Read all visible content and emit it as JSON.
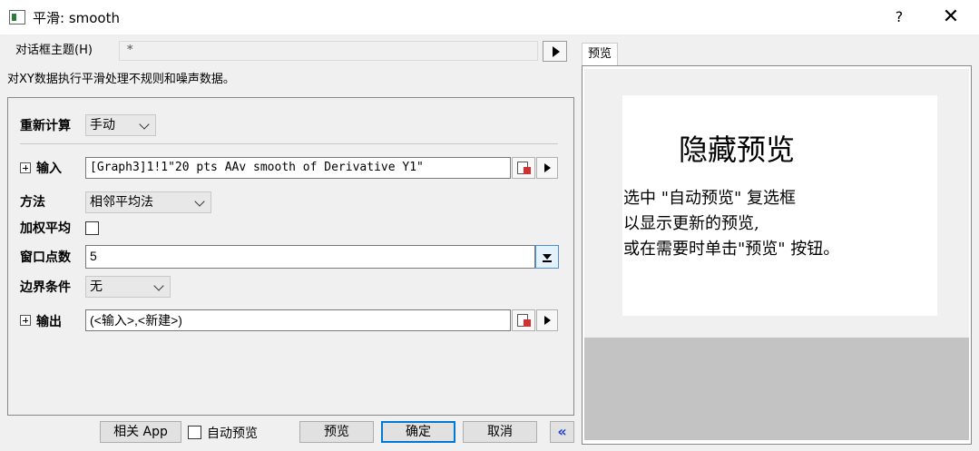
{
  "window": {
    "title": "平滑: smooth",
    "help_glyph": "?",
    "close_glyph": "✕"
  },
  "theme": {
    "label": "对话框主题(H)",
    "value": "*"
  },
  "description": "对XY数据执行平滑处理不规则和噪声数据。",
  "form": {
    "recalc": {
      "label": "重新计算",
      "value": "手动"
    },
    "input": {
      "label": "输入",
      "value": "[Graph3]1!1\"20 pts AAv smooth of Derivative Y1\""
    },
    "method": {
      "label": "方法",
      "value": "相邻平均法"
    },
    "weighted": {
      "label": "加权平均",
      "checked": false
    },
    "window_points": {
      "label": "窗口点数",
      "value": "5"
    },
    "boundary": {
      "label": "边界条件",
      "value": "无"
    },
    "output": {
      "label": "输出",
      "value": "(<输入>,<新建>)"
    }
  },
  "buttons": {
    "related_app": "相关 App",
    "auto_preview": "自动预览",
    "preview": "预览",
    "ok": "确定",
    "cancel": "取消",
    "collapse": "«"
  },
  "preview_panel": {
    "tab": "预览",
    "hidden_title": "隐藏预览",
    "message": "选中 \"自动预览\" 复选框\n以显示更新的预览,\n或在需要时单击\"预览\" 按钮。"
  }
}
